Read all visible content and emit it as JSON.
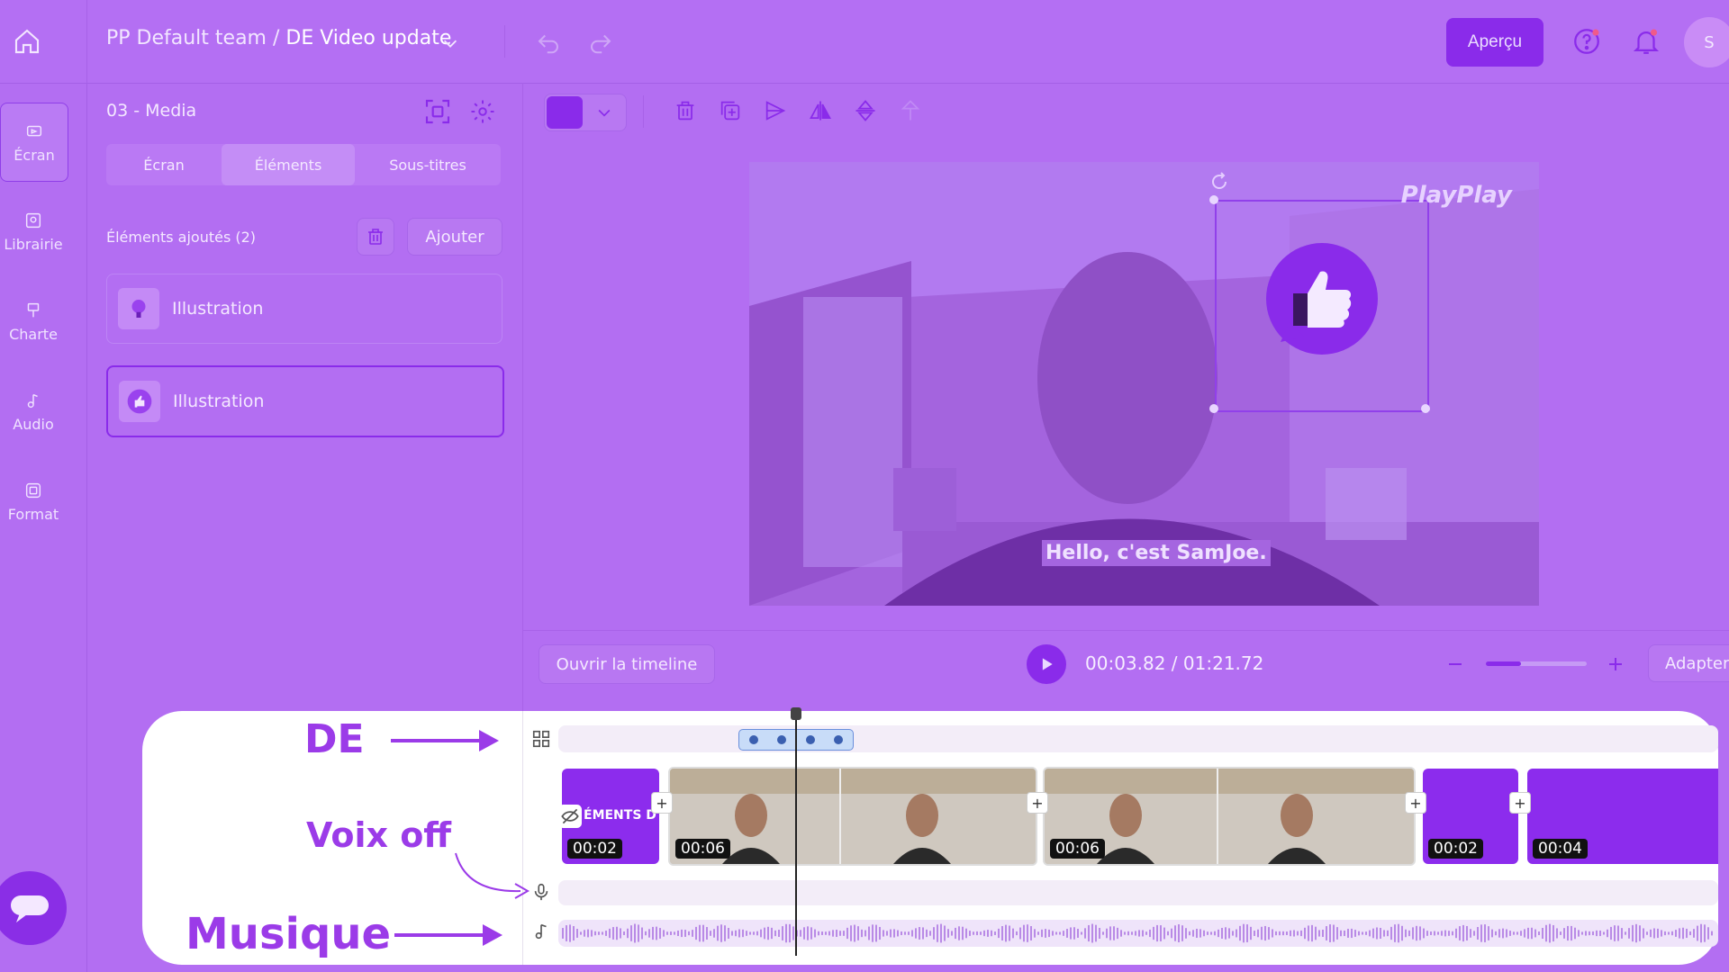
{
  "header": {
    "team": "PP Default team",
    "separator": " / ",
    "project": "DE Video update",
    "preview_label": "Aperçu",
    "avatar_initial": "S"
  },
  "rail": {
    "items": [
      {
        "label": "Écran",
        "icon": "screen-icon"
      },
      {
        "label": "Librairie",
        "icon": "library-icon"
      },
      {
        "label": "Charte",
        "icon": "brush-icon"
      },
      {
        "label": "Audio",
        "icon": "music-note-icon"
      },
      {
        "label": "Format",
        "icon": "format-icon"
      }
    ]
  },
  "panel": {
    "title": "03 - Media",
    "tabs": [
      "Écran",
      "Éléments",
      "Sous-titres"
    ],
    "added_label": "Éléments ajoutés (2)",
    "add_label": "Ajouter",
    "elements": [
      {
        "label": "Illustration",
        "icon": "lightbulb-icon"
      },
      {
        "label": "Illustration",
        "icon": "thumbs-up-icon"
      }
    ]
  },
  "toolbar": {
    "color": "#8a2bea"
  },
  "preview": {
    "logo": "PlayPlay",
    "subtitle": "Hello, c'est SamJoe."
  },
  "playback": {
    "open_timeline": "Ouvrir la timeline",
    "current_time": "00:03.82",
    "total_time": "01:21.72",
    "time_separator": " / ",
    "fit_label": "Adapter",
    "zoom_level": 0.35
  },
  "timeline": {
    "annotations": {
      "de": "DE",
      "voice": "Voix off",
      "music": "Musique"
    },
    "intro_clip_text": "ÉMENTS D",
    "clips": [
      {
        "duration": "00:02"
      },
      {
        "duration": "00:06"
      },
      {
        "duration": "00:06"
      },
      {
        "duration": "00:02"
      },
      {
        "duration": "00:04"
      }
    ]
  },
  "colors": {
    "accent": "#8a2bea",
    "overlay": "#b36ef2",
    "annotation": "#9b3be8"
  }
}
